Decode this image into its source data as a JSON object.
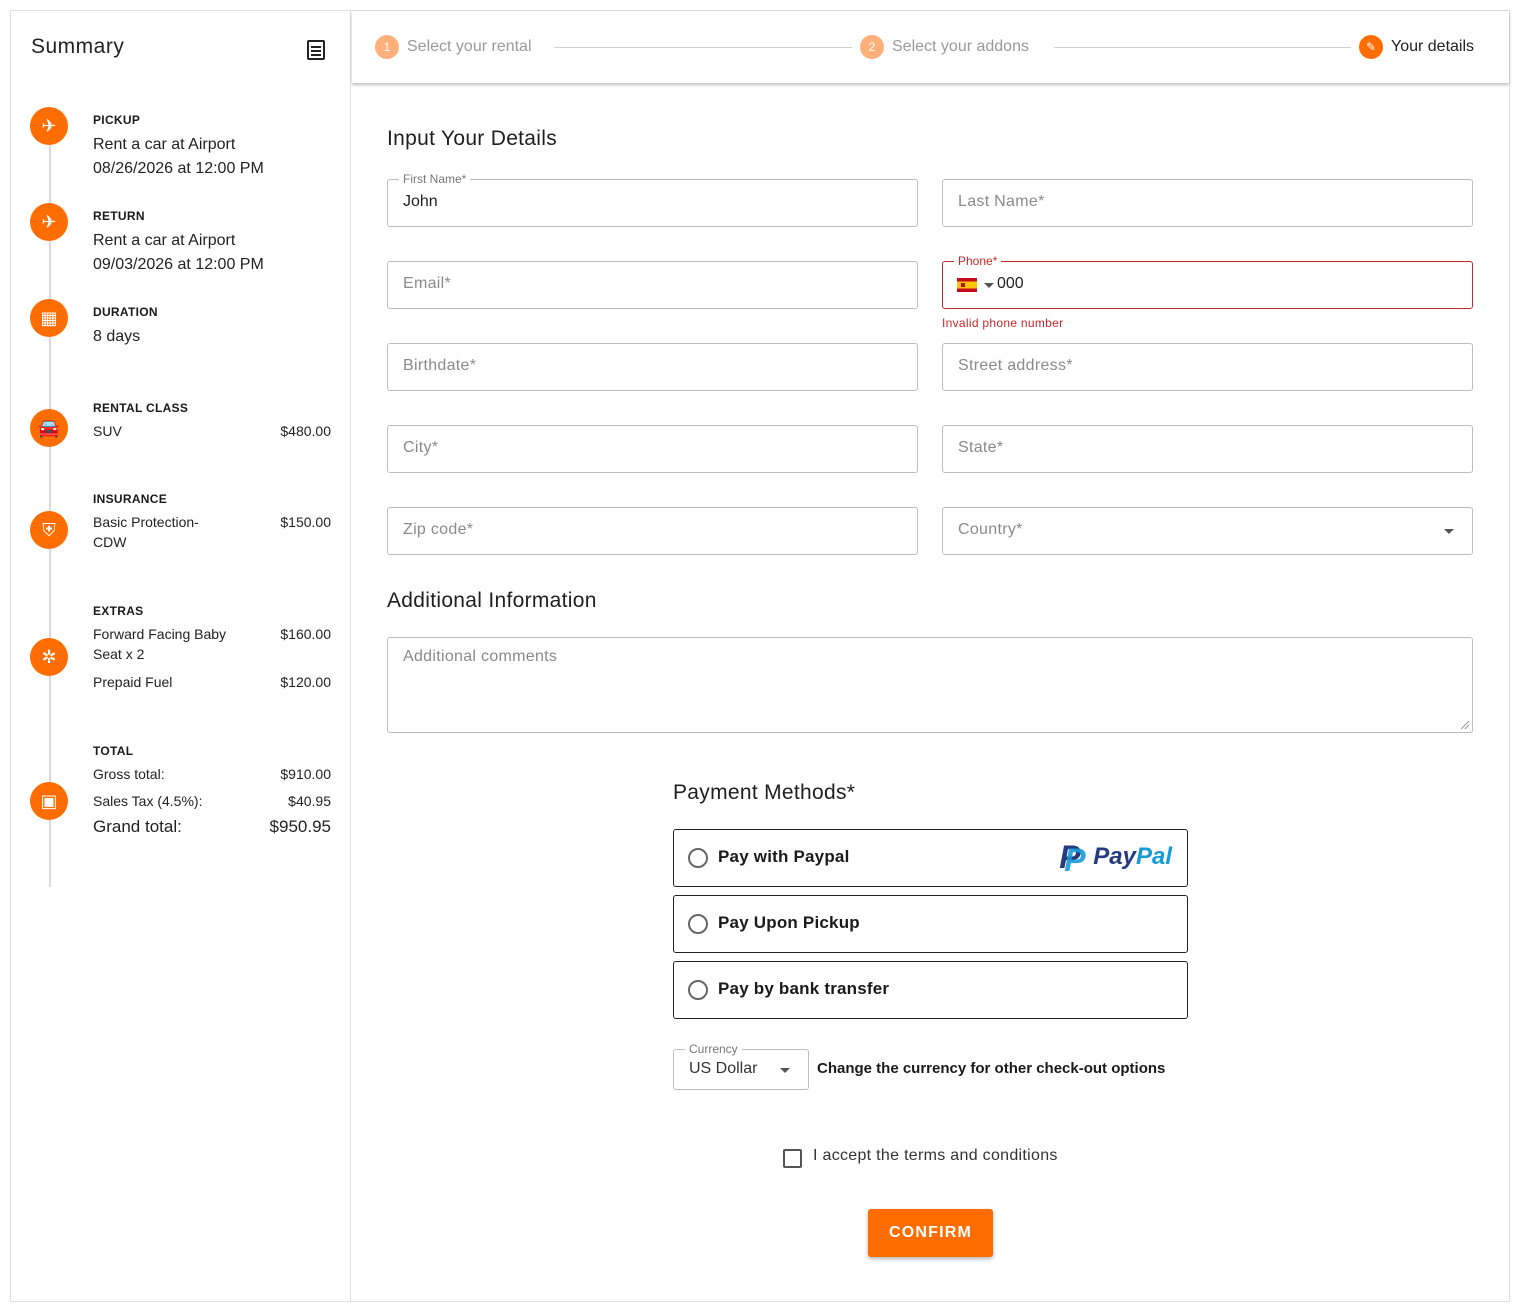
{
  "summary": {
    "title": "Summary",
    "pickup": {
      "label": "PICKUP",
      "location": "Rent a car at Airport",
      "datetime": "08/26/2026 at 12:00 PM"
    },
    "return": {
      "label": "RETURN",
      "location": "Rent a car at Airport",
      "datetime": "09/03/2026 at 12:00 PM"
    },
    "duration": {
      "label": "DURATION",
      "value": "8 days"
    },
    "rental_class": {
      "label": "RENTAL CLASS",
      "name": "SUV",
      "price": "$480.00"
    },
    "insurance": {
      "label": "INSURANCE",
      "name": "Basic Protection-CDW",
      "price": "$150.00"
    },
    "extras": {
      "label": "EXTRAS",
      "items": [
        {
          "name": "Forward Facing Baby Seat x 2",
          "price": "$160.00"
        },
        {
          "name": "Prepaid Fuel",
          "price": "$120.00"
        }
      ]
    },
    "total": {
      "label": "TOTAL",
      "gross_label": "Gross total:",
      "gross_value": "$910.00",
      "tax_label": "Sales Tax (4.5%):",
      "tax_value": "$40.95",
      "grand_label": "Grand total:",
      "grand_value": "$950.95"
    }
  },
  "stepper": {
    "steps": [
      {
        "num": "1",
        "label": "Select your rental"
      },
      {
        "num": "2",
        "label": "Select your addons"
      },
      {
        "num": "✎",
        "label": "Your details"
      }
    ]
  },
  "form": {
    "heading": "Input Your Details",
    "first_name": {
      "legend": "First Name*",
      "value": "John"
    },
    "last_name": {
      "placeholder": "Last Name*"
    },
    "email": {
      "placeholder": "Email*"
    },
    "phone": {
      "legend": "Phone*",
      "value": "000",
      "error": "Invalid phone number"
    },
    "birthdate": {
      "placeholder": "Birthdate*"
    },
    "street": {
      "placeholder": "Street address*"
    },
    "city": {
      "placeholder": "City*"
    },
    "state": {
      "placeholder": "State*"
    },
    "zip": {
      "placeholder": "Zip code*"
    },
    "country": {
      "placeholder": "Country*"
    }
  },
  "additional": {
    "heading": "Additional Information",
    "comments_placeholder": "Additional comments"
  },
  "payment": {
    "heading": "Payment Methods*",
    "options": [
      {
        "label": "Pay with Paypal"
      },
      {
        "label": "Pay Upon Pickup"
      },
      {
        "label": "Pay by bank transfer"
      }
    ],
    "paypal_logo": {
      "part1": "Pay",
      "part2": "Pal"
    },
    "currency": {
      "legend": "Currency",
      "value": "US Dollar",
      "note": "Change the currency for other check-out options"
    }
  },
  "terms_label": "I accept the terms and conditions",
  "confirm_label": "CONFIRM",
  "colors": {
    "accent": "#ff6d00",
    "error": "#c62828",
    "paypal_dark": "#253b80",
    "paypal_light": "#179bd7"
  }
}
